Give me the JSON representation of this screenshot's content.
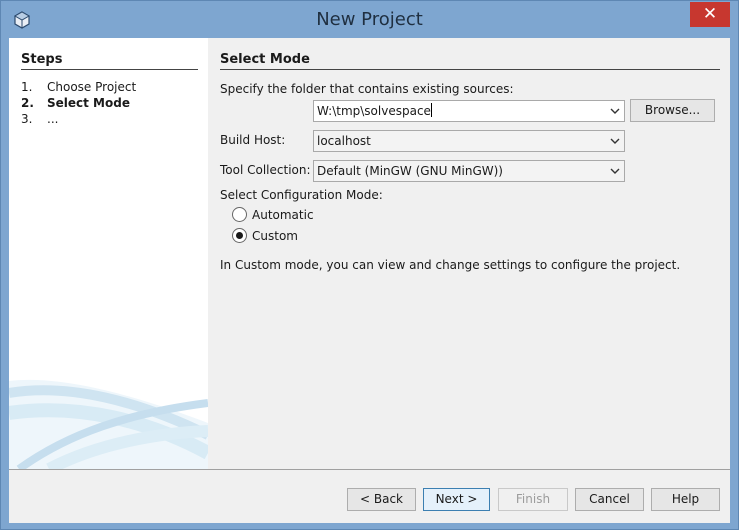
{
  "window": {
    "title": "New Project",
    "close_glyph": "✕",
    "app_icon": "cube-icon"
  },
  "steps": {
    "title": "Steps",
    "items": [
      {
        "num": "1.",
        "label": "Choose Project"
      },
      {
        "num": "2.",
        "label": "Select Mode"
      },
      {
        "num": "3.",
        "label": "..."
      }
    ]
  },
  "main": {
    "title": "Select Mode",
    "folder_label": "Specify the folder that contains existing sources:",
    "folder_value": "W:\\tmp\\solvespace",
    "browse_label": "Browse...",
    "build_host_label": "Build Host:",
    "build_host_value": "localhost",
    "tool_collection_label": "Tool Collection:",
    "tool_collection_value": "Default (MinGW (GNU MinGW))",
    "config_mode_label": "Select Configuration Mode:",
    "mode_automatic_label": "Automatic",
    "mode_custom_label": "Custom",
    "selected_mode": "Custom",
    "description": "In Custom mode, you can view and change settings to configure the project."
  },
  "footer": {
    "back_label": "< Back",
    "next_label": "Next >",
    "finish_label": "Finish",
    "cancel_label": "Cancel",
    "help_label": "Help"
  },
  "colors": {
    "title_bar": "#7ea6d0",
    "close_button": "#c7372f",
    "panel_background": "#f0f0f0"
  }
}
